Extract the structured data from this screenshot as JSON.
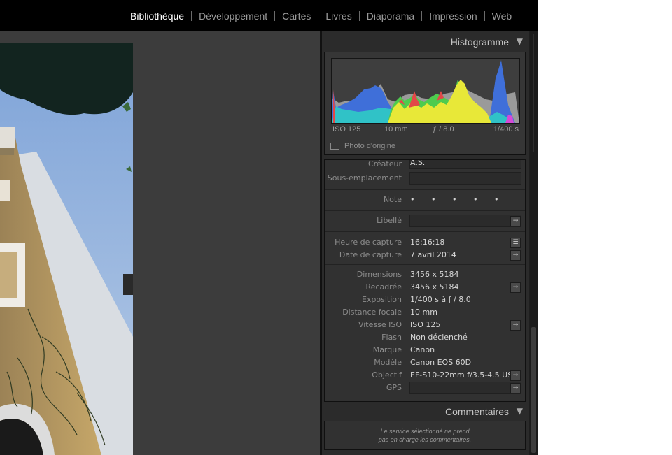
{
  "modules": {
    "items": [
      "Bibliothèque",
      "Développement",
      "Cartes",
      "Livres",
      "Diaporama",
      "Impression",
      "Web"
    ],
    "active": "Bibliothèque"
  },
  "histogram": {
    "title": "Histogramme",
    "collapse_icon": "triangle-down-icon",
    "iso": "ISO 125",
    "focal": "10 mm",
    "aperture": "ƒ / 8.0",
    "shutter": "1/400 s",
    "original_photo_label": "Photo d'origine",
    "colors": {
      "blue": "#3f6fd9",
      "cyan": "#2fc6c6",
      "green": "#4ecb4e",
      "yellow": "#e8e838",
      "red": "#e24848",
      "gray": "#9a9a9a",
      "magenta": "#d64ad6"
    }
  },
  "metadata": {
    "createur": {
      "label": "Créateur",
      "value": "A.S."
    },
    "sous_emplacement": {
      "label": "Sous-emplacement",
      "value": ""
    },
    "note": {
      "label": "Note",
      "value": "• • • • •"
    },
    "libelle": {
      "label": "Libellé",
      "value": ""
    },
    "heure": {
      "label": "Heure de capture",
      "value": "16:16:18"
    },
    "date": {
      "label": "Date de capture",
      "value": "7 avril 2014"
    },
    "dimensions": {
      "label": "Dimensions",
      "value": "3456 x 5184"
    },
    "recadree": {
      "label": "Recadrée",
      "value": "3456 x 5184"
    },
    "exposition": {
      "label": "Exposition",
      "value": "1/400 s à ƒ / 8.0"
    },
    "focale": {
      "label": "Distance focale",
      "value": "10 mm"
    },
    "iso": {
      "label": "Vitesse ISO",
      "value": "ISO 125"
    },
    "flash": {
      "label": "Flash",
      "value": "Non déclenché"
    },
    "marque": {
      "label": "Marque",
      "value": "Canon"
    },
    "modele": {
      "label": "Modèle",
      "value": "Canon EOS 60D"
    },
    "objectif": {
      "label": "Objectif",
      "value": "EF-S10-22mm f/3.5-4.5 US"
    },
    "gps": {
      "label": "GPS",
      "value": ""
    },
    "arrow_glyph": "→",
    "list_glyph": "☰"
  },
  "comments": {
    "title": "Commentaires",
    "message_line1": "Le service sélectionné ne prend",
    "message_line2": "pas en charge les commentaires."
  }
}
